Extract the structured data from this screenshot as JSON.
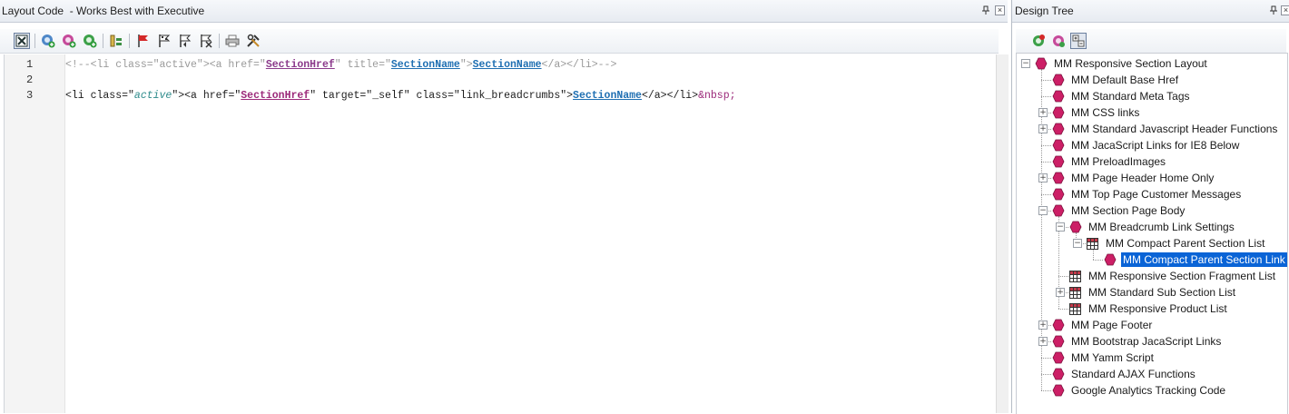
{
  "left_panel": {
    "title": "Layout Code  - Works Best with Executive",
    "pin_icon": "pin-icon",
    "close_icon": "close-icon",
    "toolbar_icons": [
      "toggle-view-icon",
      "add-section-icon",
      "add-variable-icon",
      "add-link-icon",
      "insert-snippet-icon",
      "red-flag-icon",
      "flag-icon",
      "flag-back-icon",
      "flag-clear-icon",
      "print-icon",
      "tools-icon"
    ],
    "line_numbers": [
      "1",
      "2",
      "3"
    ],
    "code": {
      "l1_a": "<!--<li class=\"active\"><a href=\"",
      "l1_var": "SectionHref",
      "l1_b": "\" title=\"",
      "l1_link1": "SectionName",
      "l1_c": "\">",
      "l1_link2": "SectionName",
      "l1_d": "</a></li>-->",
      "l3_a": "<li class=\"",
      "l3_attr": "active",
      "l3_b": "\"><a href=\"",
      "l3_var": "SectionHref",
      "l3_c": "\" target=\"_self\" class=\"link_breadcrumbs\">",
      "l3_link": "SectionName",
      "l3_d": "</a></li>",
      "l3_entity": "&nbsp;"
    }
  },
  "right_panel": {
    "title": "Design Tree",
    "pin_icon": "pin-icon",
    "close_icon": "close-icon",
    "toolbar_icons": [
      "add-node-icon",
      "remove-node-icon",
      "collapse-all-icon"
    ],
    "tree": [
      {
        "label": "MM Responsive Section Layout",
        "icon": "hex",
        "expander": "-"
      },
      {
        "label": "MM Default Base Href",
        "icon": "hex"
      },
      {
        "label": "MM Standard Meta Tags",
        "icon": "hex"
      },
      {
        "label": "MM CSS links",
        "icon": "hex",
        "expander": "+"
      },
      {
        "label": "MM Standard Javascript Header Functions",
        "icon": "hex",
        "expander": "+"
      },
      {
        "label": "MM JacaScript Links for IE8 Below",
        "icon": "hex"
      },
      {
        "label": "MM PreloadImages",
        "icon": "hex"
      },
      {
        "label": "MM Page Header Home Only",
        "icon": "hex",
        "expander": "+"
      },
      {
        "label": "MM Top Page Customer Messages",
        "icon": "hex"
      },
      {
        "label": "MM Section Page Body",
        "icon": "hex",
        "expander": "-"
      },
      {
        "label": "MM Breadcrumb Link Settings",
        "icon": "hex",
        "expander": "-"
      },
      {
        "label": "MM Compact Parent Section List",
        "icon": "grid",
        "expander": "-"
      },
      {
        "label": "MM Compact Parent Section Link",
        "icon": "hex",
        "selected": true
      },
      {
        "label": "MM Responsive Section Fragment List",
        "icon": "grid"
      },
      {
        "label": "MM Standard Sub Section List",
        "icon": "grid",
        "expander": "+"
      },
      {
        "label": "MM Responsive Product List",
        "icon": "grid"
      },
      {
        "label": "MM Page Footer",
        "icon": "hex",
        "expander": "+"
      },
      {
        "label": "MM Bootstrap JacaScript Links",
        "icon": "hex",
        "expander": "+"
      },
      {
        "label": "MM Yamm Script",
        "icon": "hex"
      },
      {
        "label": "Standard AJAX Functions",
        "icon": "hex"
      },
      {
        "label": "Google Analytics Tracking Code",
        "icon": "hex"
      }
    ]
  },
  "colors": {
    "hex_icon": "#cc1f66",
    "selection": "#0a64d6",
    "variable": "#9c2a7a",
    "link": "#1f6fb2"
  }
}
